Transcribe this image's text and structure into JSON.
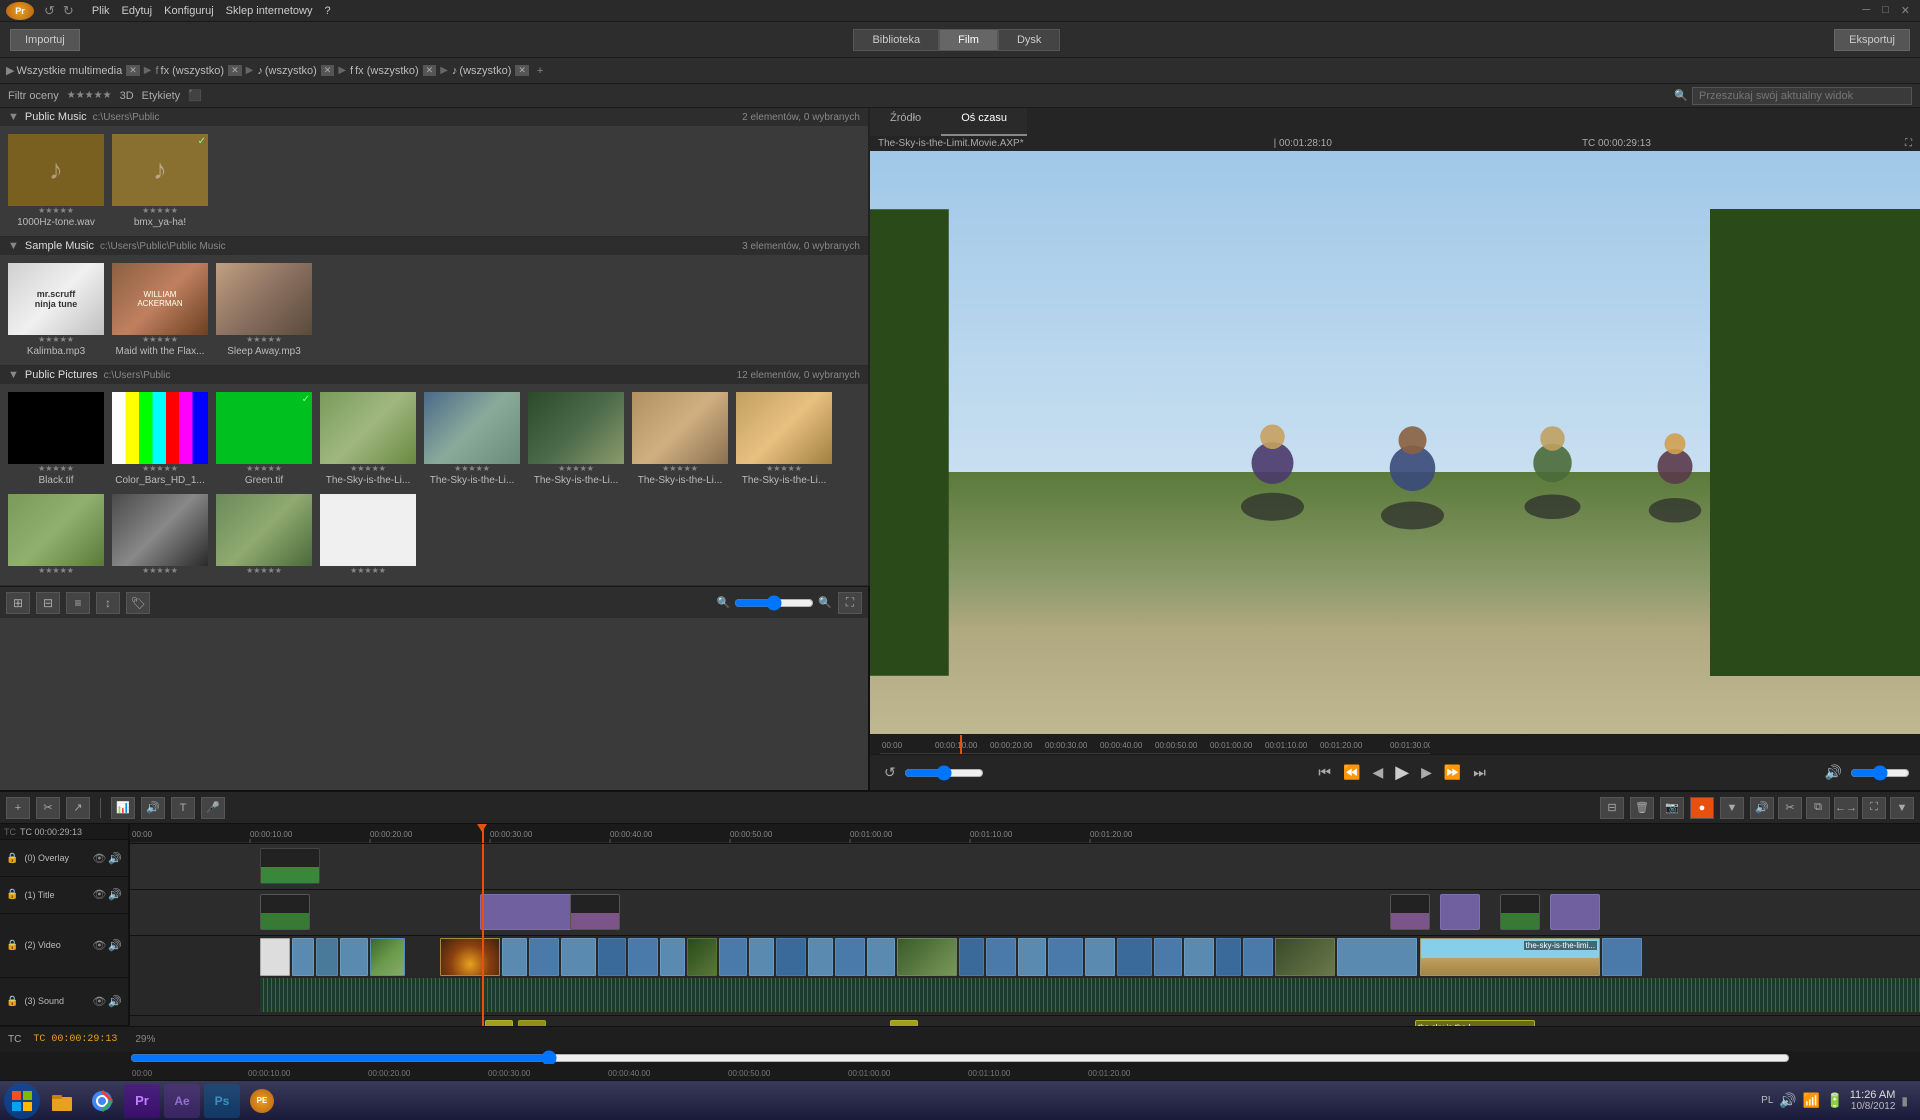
{
  "app": {
    "title": "Adobe Premiere Elements",
    "logo": "Pr"
  },
  "menu": {
    "items": [
      "Plik",
      "Edytuj",
      "Konfiguruj",
      "Sklep internetowy",
      "?"
    ]
  },
  "toolbar": {
    "importuj": "Importuj",
    "biblioteka": "Biblioteka",
    "film": "Film",
    "dysk": "Dysk",
    "eksportuj": "Eksportuj"
  },
  "breadcrumb": {
    "items": [
      "Wszystkie multimedia",
      "fx (wszystko)",
      "(wszystko)",
      "fx (wszystko)",
      "(wszystko)"
    ]
  },
  "filter": {
    "filtr_oceny": "Filtr oceny",
    "threed": "3D",
    "etykiety": "Etykiety",
    "search_placeholder": "Przeszukaj swój aktualny widok"
  },
  "media_groups": [
    {
      "name": "Public Music",
      "path": "c:\\Users\\Public",
      "count": "2 elementów, 0 wybranych",
      "items": [
        {
          "label": "1000Hz-tone.wav",
          "type": "audio"
        },
        {
          "label": "bmx_ya-ha!",
          "type": "audio2"
        }
      ]
    },
    {
      "name": "Sample Music",
      "path": "c:\\Users\\Public\\Public Music",
      "count": "3 elementów, 0 wybranych",
      "items": [
        {
          "label": "Kalimba.mp3",
          "type": "photo1"
        },
        {
          "label": "Maid with the Flax...",
          "type": "photo2"
        },
        {
          "label": "Sleep Away.mp3",
          "type": "photo3"
        }
      ]
    },
    {
      "name": "Public Pictures",
      "path": "c:\\Users\\Public",
      "count": "12 elementów, 0 wybranych",
      "items": [
        {
          "label": "Black.tif",
          "type": "black"
        },
        {
          "label": "Color_Bars_HD_1...",
          "type": "colorbars"
        },
        {
          "label": "Green.tif",
          "type": "green"
        },
        {
          "label": "The-Sky-is-the-Li...",
          "type": "photo4"
        },
        {
          "label": "The-Sky-is-the-Li...",
          "type": "photo5"
        },
        {
          "label": "The-Sky-is-the-Li...",
          "type": "photo6"
        },
        {
          "label": "The-Sky-is-the-Li...",
          "type": "photo7"
        },
        {
          "label": "The-Sky-is-the-Li...",
          "type": "photo8"
        },
        {
          "label": "",
          "type": "photo9"
        },
        {
          "label": "",
          "type": "photo10"
        },
        {
          "label": "",
          "type": "photo11"
        },
        {
          "label": "",
          "type": "white"
        }
      ]
    }
  ],
  "preview": {
    "source_tab": "Źródło",
    "timeline_tab": "Oś czasu",
    "filename": "The-Sky-is-the-Limit.Movie.AXP*",
    "timecode1": "| 00:01:28:10",
    "timecode2": "TC 00:00:29:13"
  },
  "timeline": {
    "tracks": [
      {
        "id": "0",
        "name": "(0) Overlay"
      },
      {
        "id": "1",
        "name": "(1) Title"
      },
      {
        "id": "2",
        "name": "(2) Video"
      },
      {
        "id": "3",
        "name": "(3) Sound"
      }
    ],
    "time_display": "TC  00:00:29:13",
    "zoom": "29%",
    "time_marks": [
      "00:00",
      "00:00:10.00",
      "00:00:20.00",
      "00:00:30.00",
      "00:00:40.00",
      "00:00:50.00",
      "00:01:00.00",
      "00:01:10.00",
      "00:01:20.00"
    ]
  },
  "taskbar": {
    "system_time": "11:26 AM",
    "system_date": "10/8/2012",
    "keyboard": "PL"
  }
}
